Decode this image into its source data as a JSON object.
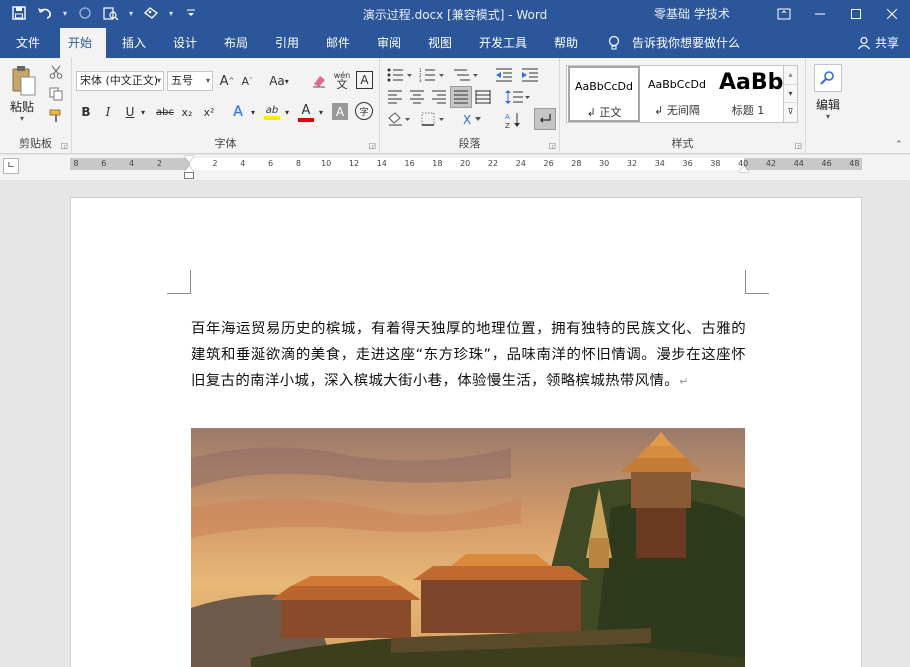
{
  "titlebar": {
    "title": "演示过程.docx [兼容模式]  -  Word",
    "user": "零基础 学技术",
    "icons": [
      "save-icon",
      "undo-icon",
      "redo-icon",
      "print-preview-icon",
      "touch-mode-icon",
      "customize-icon"
    ]
  },
  "tabs": [
    "文件",
    "开始",
    "插入",
    "设计",
    "布局",
    "引用",
    "邮件",
    "审阅",
    "视图",
    "开发工具",
    "帮助"
  ],
  "active_tab": "开始",
  "tell_me": "告诉我你想要做什么",
  "share": "共享",
  "clipboard": {
    "paste": "粘贴",
    "label": "剪贴板"
  },
  "font": {
    "name": "宋体 (中文正文)",
    "size": "五号",
    "label": "字体",
    "bold": "B",
    "italic": "I",
    "underline": "U",
    "strike": "abc",
    "sub": "x₂",
    "sup": "x²",
    "grow": "A",
    "shrink": "A",
    "case": "Aa",
    "phonetic": "wén",
    "border": "A",
    "effects": "A",
    "highlight": "ab",
    "color": "A",
    "shade": "A",
    "enclose": "字"
  },
  "paragraph": {
    "label": "段落"
  },
  "styles": {
    "label": "样式",
    "items": [
      {
        "preview": "AaBbCcDd",
        "name": "↲ 正文"
      },
      {
        "preview": "AaBbCcDd",
        "name": "↲ 无间隔"
      },
      {
        "preview": "AaBb",
        "name": "标题 1"
      }
    ]
  },
  "editing": {
    "label": "编辑"
  },
  "ruler": {
    "labels": [
      "8",
      "6",
      "4",
      "2",
      "",
      "2",
      "4",
      "6",
      "8",
      "10",
      "12",
      "14",
      "16",
      "18",
      "20",
      "22",
      "24",
      "26",
      "28",
      "30",
      "32",
      "34",
      "36",
      "38",
      "40",
      "42",
      "44",
      "46",
      "48"
    ]
  },
  "document": {
    "paragraph": "百年海运贸易历史的槟城，有着得天独厚的地理位置，拥有独特的民族文化、古雅的建筑和垂涎欲滴的美食，走进这座“东方珍珠”，品味南洋的怀旧情调。漫步在这座怀旧复古的南洋小城，深入槟城大街小巷，体验慢生活，领略槟城热带风情。",
    "mark": "↵"
  },
  "colors": {
    "brand": "#2b579a",
    "ribbon": "#f3f3f3",
    "workspace": "#e6e6e6"
  }
}
